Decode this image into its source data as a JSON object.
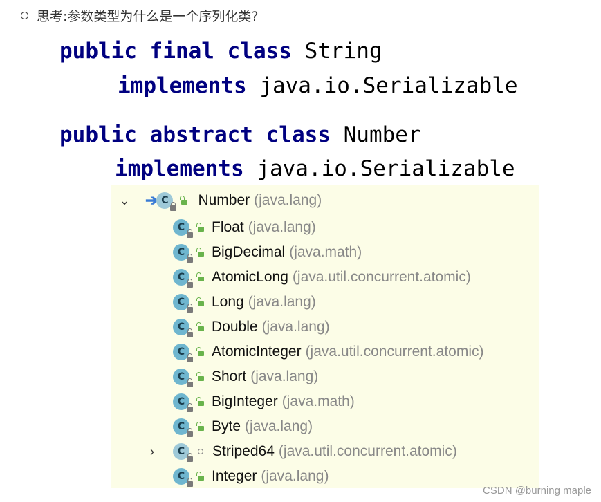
{
  "bullet_text": "思考:参数类型为什么是一个序列化类?",
  "code": {
    "line1": {
      "kw1": "public",
      "kw2": "final",
      "kw3": "class",
      "name": "String"
    },
    "line2": {
      "kw": "implements",
      "iface": "java.io.Serializable"
    },
    "line3": {
      "kw1": "public",
      "kw2": "abstract",
      "kw3": "class",
      "name": "Number"
    },
    "line4": {
      "kw": "implements",
      "iface": "java.io.Serializable"
    }
  },
  "hierarchy": {
    "root": {
      "name": "Number",
      "pkg": "(java.lang)",
      "icon_letter": "C"
    },
    "children": [
      {
        "name": "Float",
        "pkg": "(java.lang)",
        "icon_letter": "C"
      },
      {
        "name": "BigDecimal",
        "pkg": "(java.math)",
        "icon_letter": "C"
      },
      {
        "name": "AtomicLong",
        "pkg": "(java.util.concurrent.atomic)",
        "icon_letter": "C"
      },
      {
        "name": "Long",
        "pkg": "(java.lang)",
        "icon_letter": "C"
      },
      {
        "name": "Double",
        "pkg": "(java.lang)",
        "icon_letter": "C"
      },
      {
        "name": "AtomicInteger",
        "pkg": "(java.util.concurrent.atomic)",
        "icon_letter": "C"
      },
      {
        "name": "Short",
        "pkg": "(java.lang)",
        "icon_letter": "C"
      },
      {
        "name": "BigInteger",
        "pkg": "(java.math)",
        "icon_letter": "C"
      },
      {
        "name": "Byte",
        "pkg": "(java.lang)",
        "icon_letter": "C"
      },
      {
        "name": "Striped64",
        "pkg": "(java.util.concurrent.atomic)",
        "icon_letter": "C"
      },
      {
        "name": "Integer",
        "pkg": "(java.lang)",
        "icon_letter": "C"
      }
    ]
  },
  "watermark": "CSDN @burning maple",
  "colors": {
    "keyword": "#000080",
    "panel_bg": "#fcfde7",
    "class_icon": "#6fb6cf",
    "public_lock": "#69b34c"
  }
}
